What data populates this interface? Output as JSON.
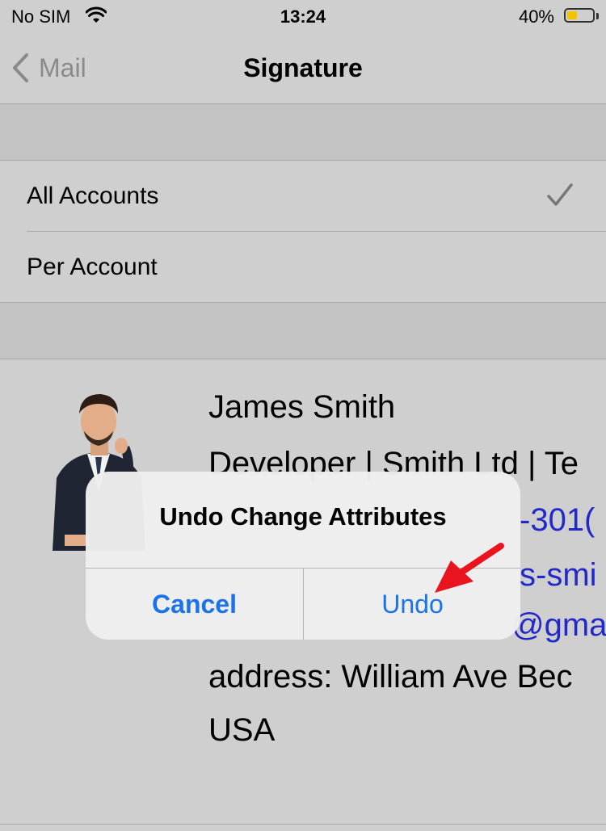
{
  "status_bar": {
    "carrier": "No SIM",
    "time": "13:24",
    "battery_percent": "40%",
    "battery_level": 0.4,
    "battery_color": "#f4c300"
  },
  "nav": {
    "back_label": "Mail",
    "title": "Signature"
  },
  "options": [
    {
      "label": "All Accounts",
      "selected": true
    },
    {
      "label": "Per Account",
      "selected": false
    }
  ],
  "signature": {
    "name": "James Smith",
    "line2": "Developer | Smith Ltd | Te",
    "line3": "-301(",
    "line4": "s-smi",
    "line5": "@gma",
    "line6": "address:  William Ave Bec",
    "line7": "USA"
  },
  "alert": {
    "title": "Undo Change Attributes",
    "cancel_label": "Cancel",
    "undo_label": "Undo"
  },
  "colors": {
    "accent": "#1a73e8",
    "link": "#2328c8",
    "annotation_arrow": "#e8141e"
  }
}
